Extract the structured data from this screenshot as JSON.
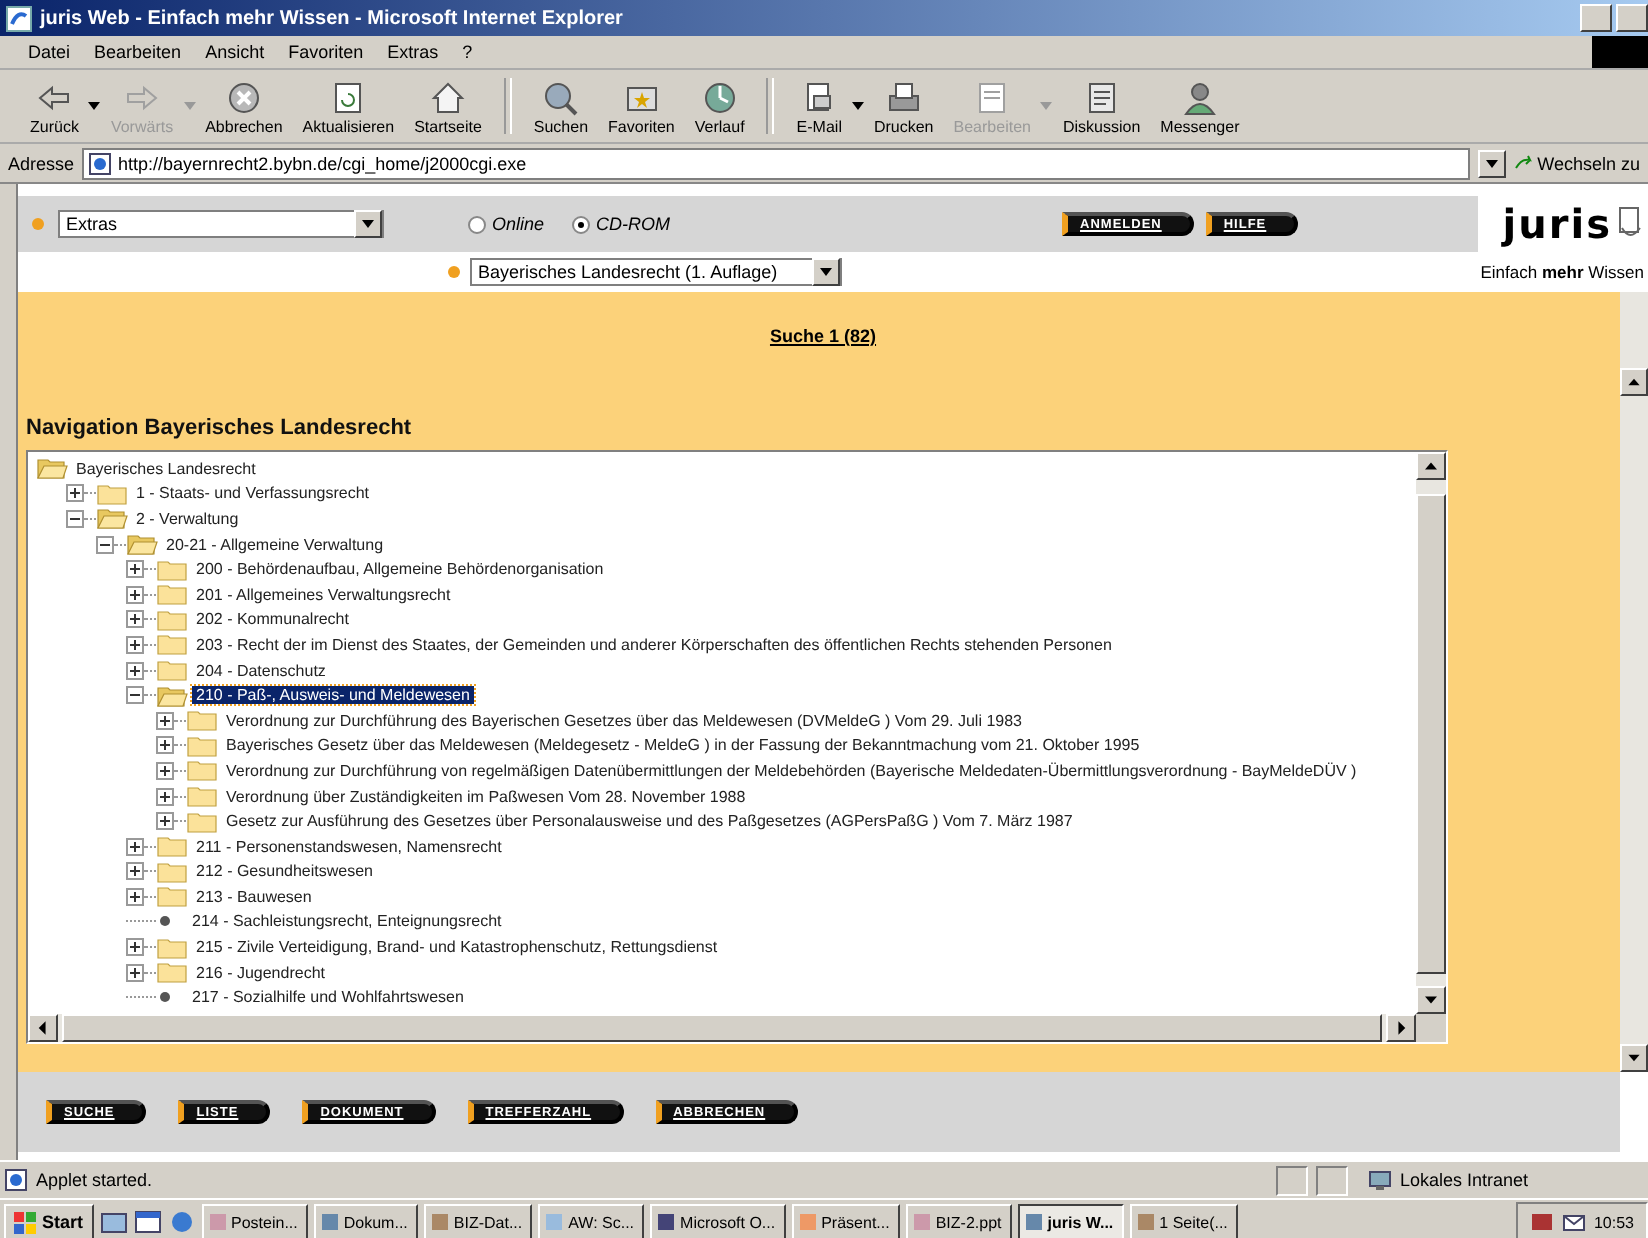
{
  "window": {
    "title": "juris Web - Einfach mehr Wissen - Microsoft Internet Explorer"
  },
  "menu": [
    "Datei",
    "Bearbeiten",
    "Ansicht",
    "Favoriten",
    "Extras",
    "?"
  ],
  "toolbar": [
    {
      "label": "Zurück",
      "disabled": false,
      "dropdown": true
    },
    {
      "label": "Vorwärts",
      "disabled": true,
      "dropdown": true
    },
    {
      "label": "Abbrechen",
      "disabled": false,
      "dropdown": false
    },
    {
      "label": "Aktualisieren",
      "disabled": false,
      "dropdown": false
    },
    {
      "label": "Startseite",
      "disabled": false,
      "dropdown": false
    },
    {
      "label": "Suchen",
      "disabled": false,
      "dropdown": false
    },
    {
      "label": "Favoriten",
      "disabled": false,
      "dropdown": false
    },
    {
      "label": "Verlauf",
      "disabled": false,
      "dropdown": false
    },
    {
      "label": "E-Mail",
      "disabled": false,
      "dropdown": true
    },
    {
      "label": "Drucken",
      "disabled": false,
      "dropdown": false
    },
    {
      "label": "Bearbeiten",
      "disabled": true,
      "dropdown": true
    },
    {
      "label": "Diskussion",
      "disabled": false,
      "dropdown": false
    },
    {
      "label": "Messenger",
      "disabled": false,
      "dropdown": false
    }
  ],
  "address": {
    "label": "Adresse",
    "value": "http://bayernrecht2.bybn.de/cgi_home/j2000cgi.exe",
    "go": "Wechseln zu"
  },
  "page": {
    "mode_select": {
      "value": "Extras"
    },
    "sources": [
      {
        "label": "Online",
        "selected": false
      },
      {
        "label": "CD-ROM",
        "selected": true
      }
    ],
    "top_buttons": [
      "ANMELDEN",
      "HILFE"
    ],
    "logo": "juris",
    "slogan": "Einfach **mehr** Wissen",
    "collection_select": {
      "value": "Bayerisches Landesrecht (1. Auflage)"
    },
    "search_link": "Suche 1 (82)",
    "heading": "Navigation  Bayerisches Landesrecht",
    "tree": {
      "label": "Bayerisches Landesrecht",
      "kind": "root",
      "expanded": true,
      "selected": false,
      "children": [
        {
          "label": "1 - Staats- und Verfassungsrecht",
          "kind": "folder",
          "expanded": false,
          "selected": false
        },
        {
          "label": "2 - Verwaltung",
          "kind": "folder",
          "expanded": true,
          "selected": false,
          "children": [
            {
              "label": "20-21 -  Allgemeine Verwaltung",
              "kind": "folder",
              "expanded": true,
              "selected": false,
              "children": [
                {
                  "label": "200 -  Behördenaufbau, Allgemeine Behördenorganisation",
                  "kind": "folder",
                  "expanded": false,
                  "selected": false
                },
                {
                  "label": "201 - Allgemeines Verwaltungsrecht",
                  "kind": "folder",
                  "expanded": false,
                  "selected": false
                },
                {
                  "label": "202 - Kommunalrecht",
                  "kind": "folder",
                  "expanded": false,
                  "selected": false
                },
                {
                  "label": "203 - Recht der im Dienst des Staates, der Gemeinden und anderer Körperschaften des öffentlichen Rechts stehenden Personen",
                  "kind": "folder",
                  "expanded": false,
                  "selected": false
                },
                {
                  "label": "204 - Datenschutz",
                  "kind": "folder",
                  "expanded": false,
                  "selected": false
                },
                {
                  "label": "210 - Paß-, Ausweis- und Meldewesen",
                  "kind": "folder",
                  "expanded": true,
                  "selected": true,
                  "children": [
                    {
                      "label": "Verordnung zur Durchführung des Bayerischen Gesetzes über das Meldewesen (DVMeldeG ) Vom 29. Juli 1983",
                      "kind": "folder",
                      "expanded": false,
                      "selected": false
                    },
                    {
                      "label": "Bayerisches Gesetz über das Meldewesen (Meldegesetz - MeldeG ) in der Fassung der Bekanntmachung vom 21. Oktober 1995",
                      "kind": "folder",
                      "expanded": false,
                      "selected": false
                    },
                    {
                      "label": "Verordnung zur Durchführung von regelmäßigen Datenübermittlungen der Meldebehörden (Bayerische Meldedaten-Übermittlungsverordnung - BayMeldeDÜV )",
                      "kind": "folder",
                      "expanded": false,
                      "selected": false
                    },
                    {
                      "label": "Verordnung über Zuständigkeiten im Paßwesen Vom 28. November 1988",
                      "kind": "folder",
                      "expanded": false,
                      "selected": false
                    },
                    {
                      "label": "Gesetz zur Ausführung des Gesetzes über Personalausweise und des Paßgesetzes (AGPersPaßG ) Vom 7. März 1987",
                      "kind": "folder",
                      "expanded": false,
                      "selected": false
                    }
                  ]
                },
                {
                  "label": "211 - Personenstandswesen, Namensrecht",
                  "kind": "folder",
                  "expanded": false,
                  "selected": false
                },
                {
                  "label": "212 - Gesundheitswesen",
                  "kind": "folder",
                  "expanded": false,
                  "selected": false
                },
                {
                  "label": "213 - Bauwesen",
                  "kind": "folder",
                  "expanded": false,
                  "selected": false
                },
                {
                  "label": "214 - Sachleistungsrecht, Enteignungsrecht",
                  "kind": "leaf",
                  "selected": false
                },
                {
                  "label": "215 - Zivile Verteidigung, Brand- und Katastrophenschutz, Rettungsdienst",
                  "kind": "folder",
                  "expanded": false,
                  "selected": false
                },
                {
                  "label": "216 - Jugendrecht",
                  "kind": "folder",
                  "expanded": false,
                  "selected": false
                },
                {
                  "label": "217 - Sozialhilfe und Wohlfahrtswesen",
                  "kind": "leaf",
                  "selected": false
                }
              ]
            }
          ]
        }
      ]
    },
    "bottom_buttons": [
      "SUCHE",
      "LISTE",
      "DOKUMENT",
      "TREFFERZAHL",
      "ABBRECHEN"
    ]
  },
  "status_bar": {
    "message": "Applet started.",
    "zone": "Lokales Intranet"
  },
  "taskbar": {
    "start": "Start",
    "tasks": [
      {
        "label": "Postein...",
        "selected": false
      },
      {
        "label": "Dokum...",
        "selected": false
      },
      {
        "label": "BIZ-Dat...",
        "selected": false
      },
      {
        "label": "AW: Sc...",
        "selected": false
      },
      {
        "label": "Microsoft O...",
        "selected": false
      },
      {
        "label": "Präsent...",
        "selected": false
      },
      {
        "label": "BIZ-2.ppt",
        "selected": false
      },
      {
        "label": "juris W...",
        "selected": true
      },
      {
        "label": "1 Seite(...",
        "selected": false
      }
    ],
    "clock": "10:53"
  }
}
